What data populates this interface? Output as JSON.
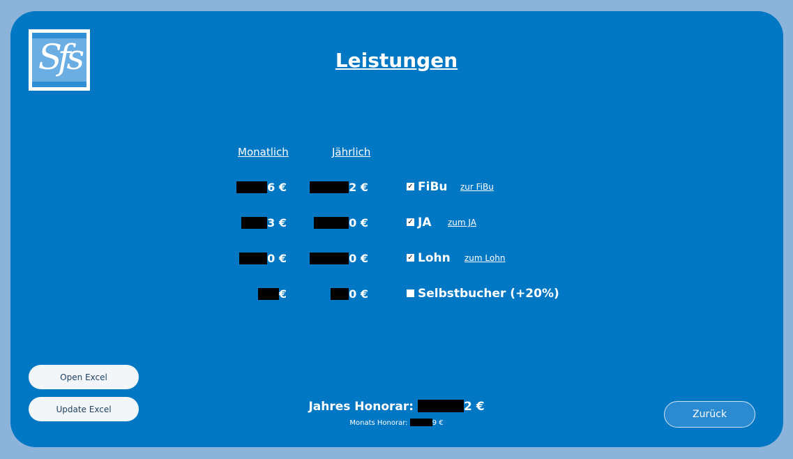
{
  "page": {
    "title": "Leistungen",
    "logo_text": "Sfs"
  },
  "columns": {
    "monthly": "Monatlich",
    "yearly": "Jährlich"
  },
  "services": [
    {
      "monthly_suffix": "6 €",
      "yearly_suffix": "2 €",
      "label": "FiBu",
      "checked": true,
      "link": "zur FiBu"
    },
    {
      "monthly_suffix": "3 €",
      "yearly_suffix": "0 €",
      "label": "JA",
      "checked": true,
      "link": "zum JA"
    },
    {
      "monthly_suffix": "0 €",
      "yearly_suffix": "0 €",
      "label": "Lohn",
      "checked": true,
      "link": "zum Lohn"
    },
    {
      "monthly_suffix": "€",
      "yearly_suffix": "0 €",
      "label": "Selbstbucher (+20%)",
      "checked": false,
      "link": ""
    }
  ],
  "check_mark": "✓",
  "buttons": {
    "open_excel": "Open Excel",
    "update_excel": "Update Excel",
    "back": "Zurück"
  },
  "totals": {
    "yearly_label": "Jahres Honorar:",
    "yearly_suffix": "2 €",
    "monthly_label": "Monats Honorar:",
    "monthly_suffix": "9 €"
  }
}
